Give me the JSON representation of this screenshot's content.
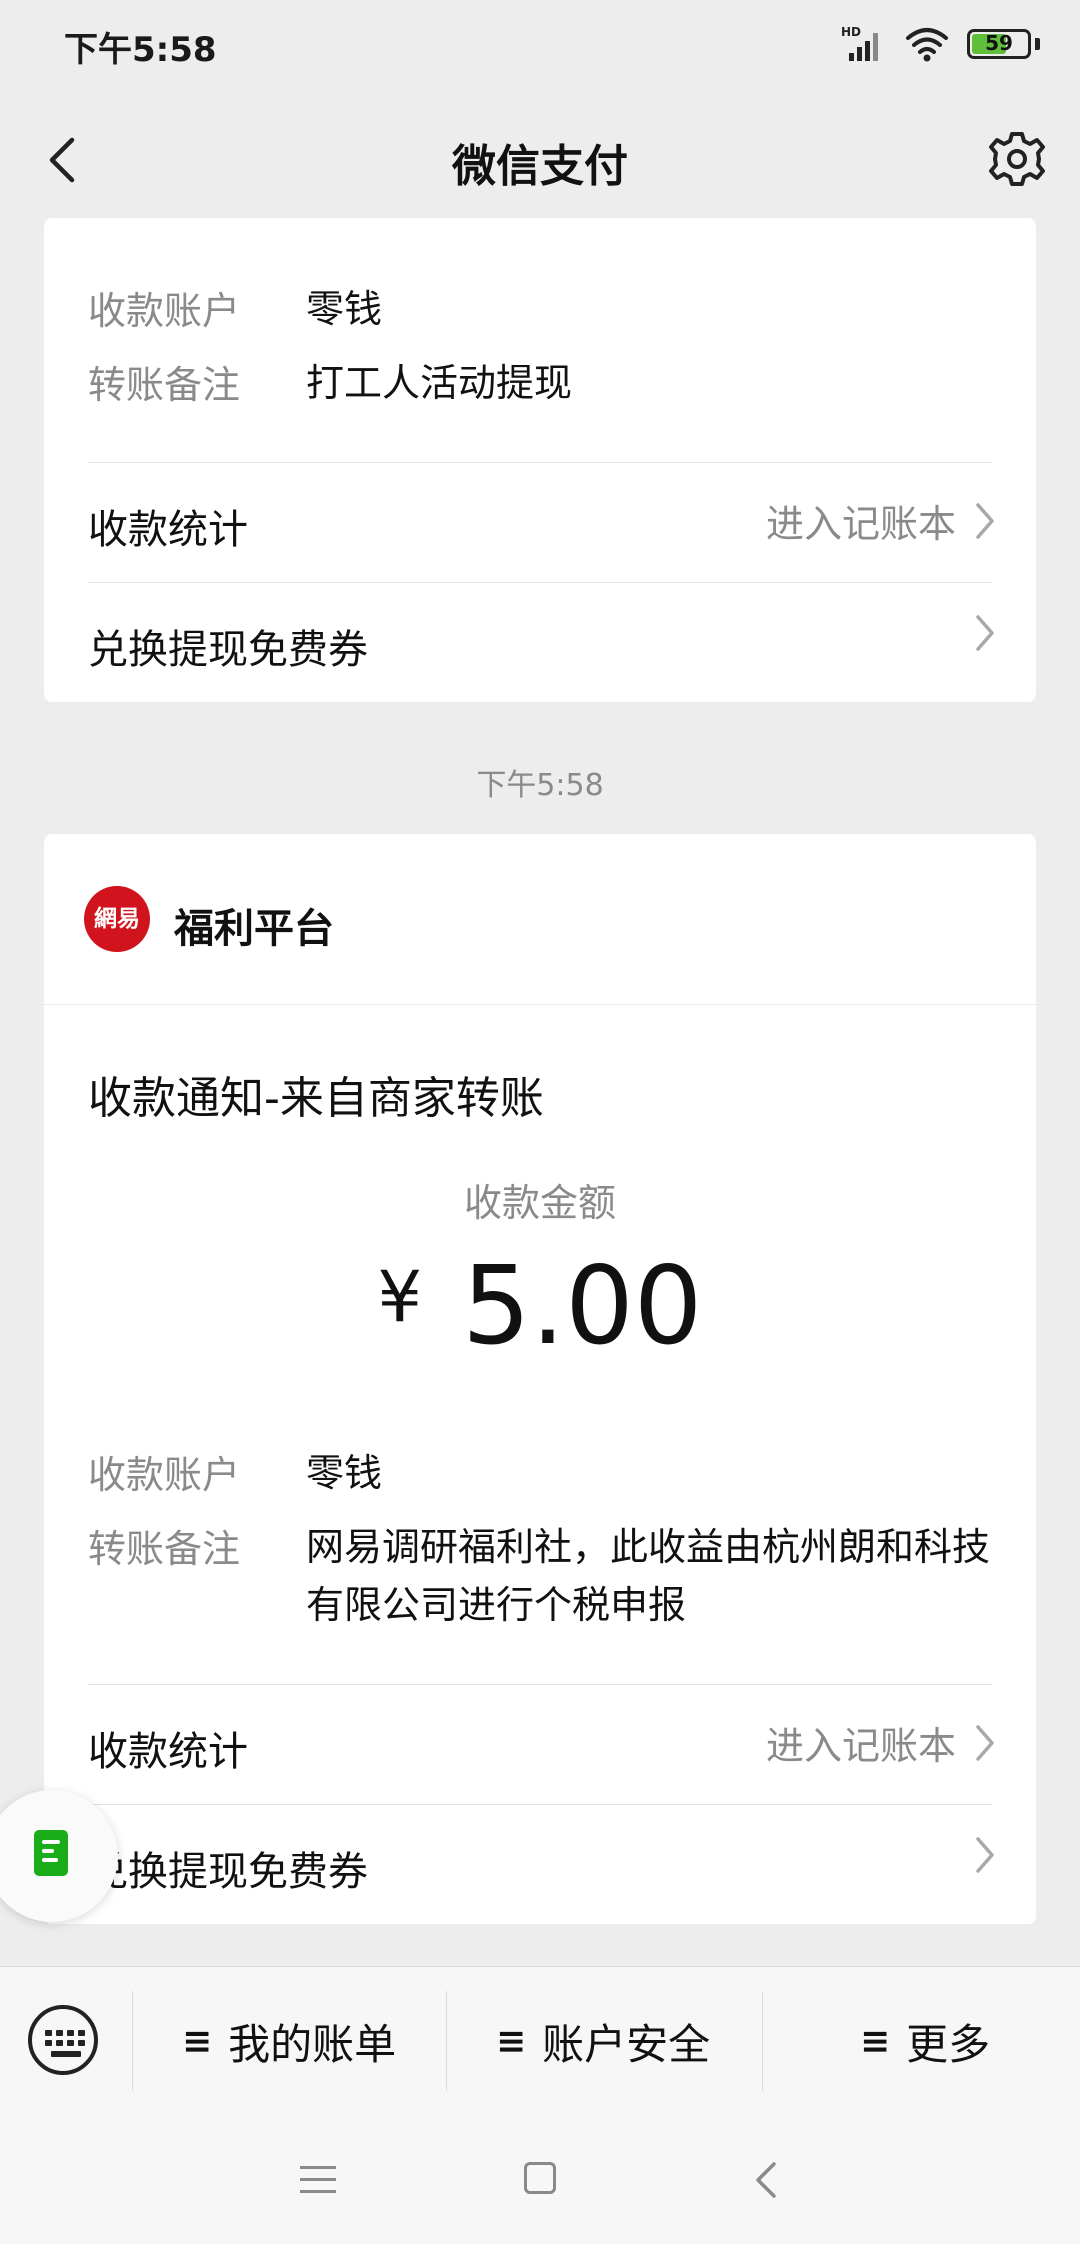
{
  "status_bar": {
    "time": "下午5:58",
    "network": "HD",
    "battery": "59"
  },
  "header": {
    "title": "微信支付",
    "back_icon": "chevron-left-icon",
    "settings_icon": "gear-icon"
  },
  "card1": {
    "account_label": "收款账户",
    "account_value": "零钱",
    "note_label": "转账备注",
    "note_value": "打工人活动提现",
    "stats_label": "收款统计",
    "stats_hint": "进入记账本",
    "coupon_label": "兑换提现免费券"
  },
  "timestamp": "下午5:58",
  "card2": {
    "merchant_logo_text": "網易",
    "merchant_name": "福利平台",
    "notice_title": "收款通知-来自商家转账",
    "amount_label": "收款金额",
    "currency": "¥",
    "amount": "5.00",
    "account_label": "收款账户",
    "account_value": "零钱",
    "note_label": "转账备注",
    "note_value": "网易调研福利社，此收益由杭州朗和科技有限公司进行个税申报",
    "stats_label": "收款统计",
    "stats_hint": "进入记账本",
    "coupon_label": "兑换提现免费券"
  },
  "bottom_menu": {
    "menu_icon_glyph": "≡",
    "items": [
      {
        "label": "我的账单"
      },
      {
        "label": "账户安全"
      },
      {
        "label": "更多"
      }
    ]
  },
  "colors": {
    "accent_green": "#1aad19",
    "logo_red": "#d0131c",
    "background": "#ededed"
  }
}
